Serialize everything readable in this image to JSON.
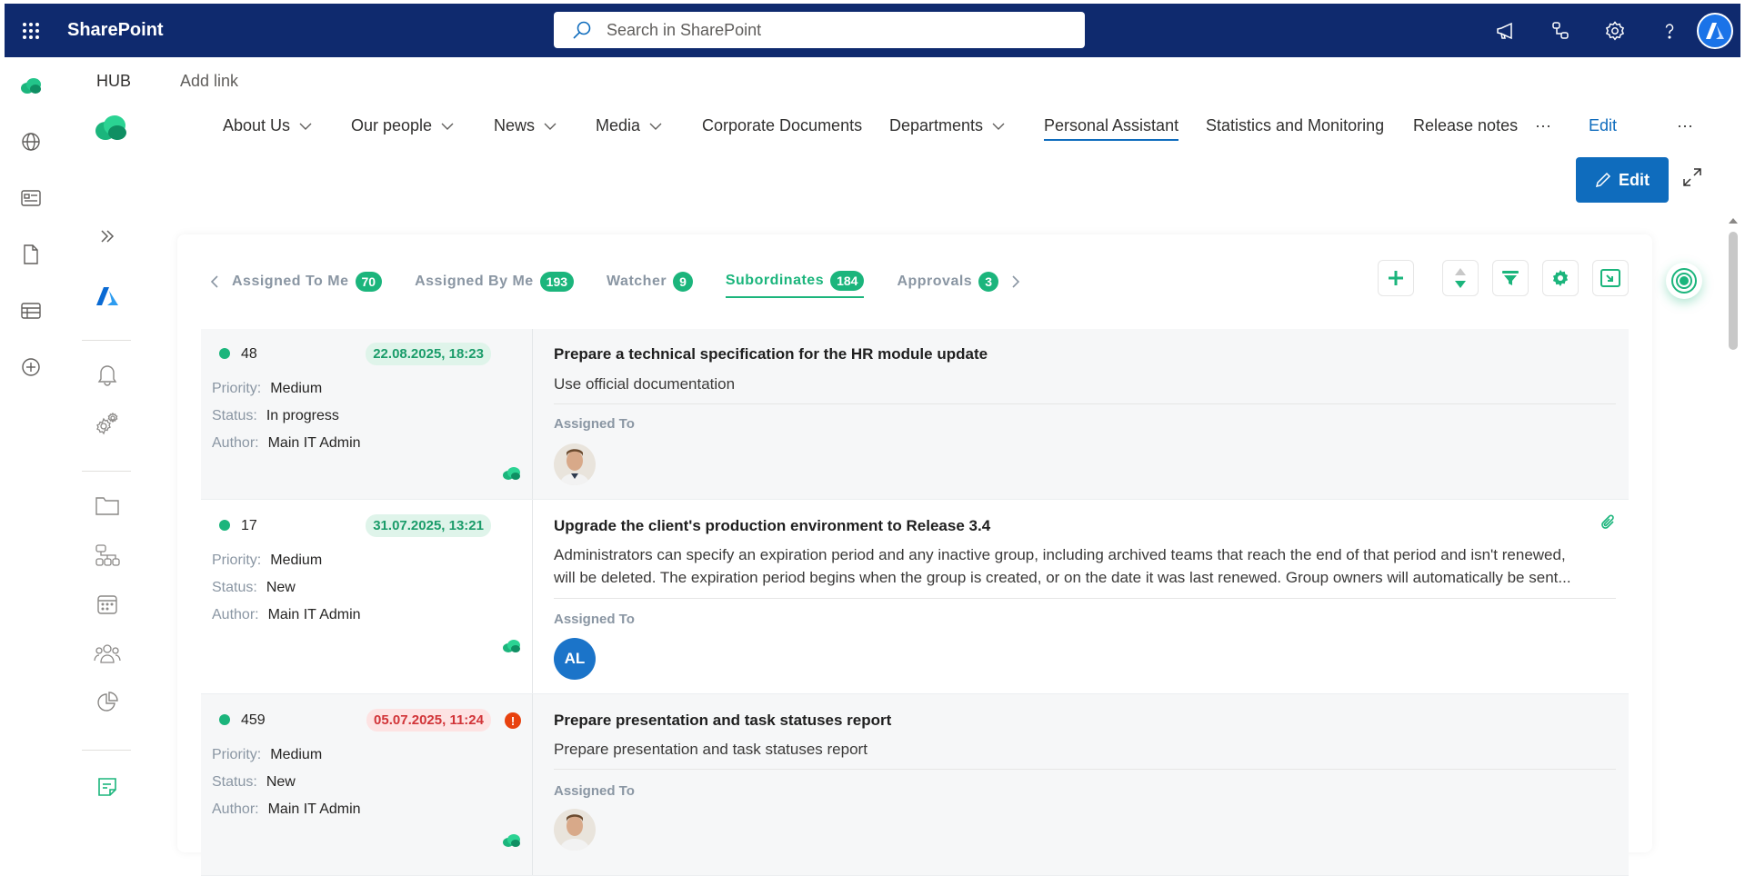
{
  "suite": {
    "brand": "SharePoint",
    "search_placeholder": "Search in SharePoint"
  },
  "hub": {
    "home_label": "HUB",
    "add_link_label": "Add link"
  },
  "nav": {
    "items": [
      {
        "label": "About Us"
      },
      {
        "label": "Our people"
      },
      {
        "label": "News"
      },
      {
        "label": "Media"
      },
      {
        "label": "Corporate Documents"
      },
      {
        "label": "Departments"
      },
      {
        "label": "Personal Assistant"
      },
      {
        "label": "Statistics and Monitoring"
      },
      {
        "label": "Release notes"
      }
    ],
    "more_label": "···",
    "edit_link_label": "Edit",
    "ellipsis_label": "···"
  },
  "page": {
    "edit_button_label": "Edit"
  },
  "tabs": [
    {
      "label": "Assigned To Me",
      "count": "70"
    },
    {
      "label": "Assigned By Me",
      "count": "193"
    },
    {
      "label": "Watcher",
      "count": "9"
    },
    {
      "label": "Subordinates",
      "count": "184"
    },
    {
      "label": "Approvals",
      "count": "3"
    }
  ],
  "active_tab": "Subordinates",
  "labels": {
    "priority": "Priority:",
    "status": "Status:",
    "author": "Author:",
    "assigned_to": "Assigned To"
  },
  "tasks": [
    {
      "id": "48",
      "date": "22.08.2025, 18:23",
      "overdue": false,
      "priority": "Medium",
      "status": "In progress",
      "author": "Main IT Admin",
      "title": "Prepare a technical specification for the HR module update",
      "description": "Use official documentation",
      "assignee_initials": ""
    },
    {
      "id": "17",
      "date": "31.07.2025, 13:21",
      "overdue": false,
      "priority": "Medium",
      "status": "New",
      "author": "Main IT Admin",
      "title": "Upgrade the client's production environment to Release 3.4",
      "description_line1": "Administrators can specify an expiration period and any inactive group, including archived teams that reach the end of that period and isn't renewed,",
      "description_line2": "will be deleted. The expiration period begins when the group is created, or on the date it was last renewed. Group owners will automatically be sent...",
      "assignee_initials": "AL"
    },
    {
      "id": "459",
      "date": "05.07.2025, 11:24",
      "overdue": true,
      "warning": "!",
      "priority": "Medium",
      "status": "New",
      "author": "Main IT Admin",
      "title": "Prepare presentation and task statuses report",
      "description": "Prepare presentation and task statuses report",
      "assignee_initials": ""
    }
  ],
  "colors": {
    "suite_bar": "#0f2a6e",
    "accent_green": "#1bb57c",
    "primary_blue": "#0f6cbd",
    "overdue_red": "#d13438"
  }
}
